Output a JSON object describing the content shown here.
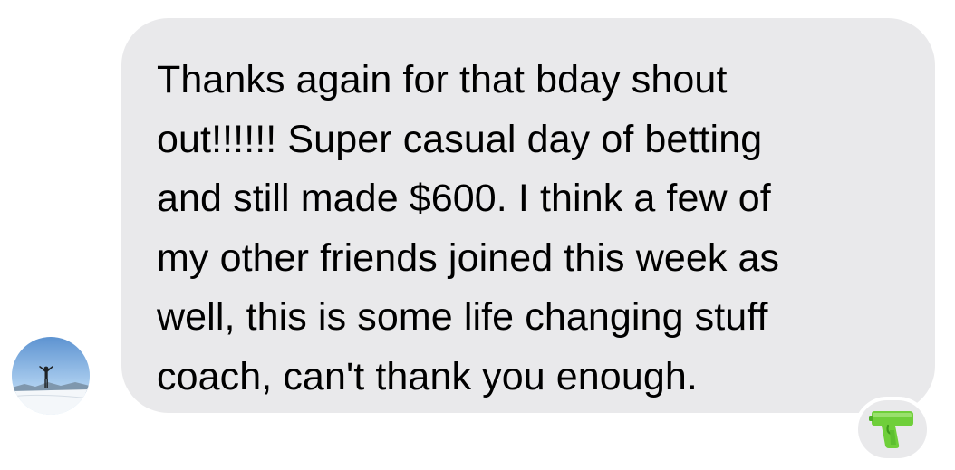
{
  "message": {
    "lines": [
      "Thanks again for that bday shout",
      "out!!!!!! Super casual day of betting",
      "and still made $600. I think a few of",
      "my other friends joined this week as",
      "well, this is some life changing stuff",
      "coach, can't thank you enough."
    ]
  },
  "sender": {
    "avatar_icon": "person-on-mountain-avatar-icon"
  },
  "reaction": {
    "emoji_icon": "water-pistol-icon",
    "color": "#6fcf3a"
  },
  "colors": {
    "bubble": "#e9e9eb",
    "text": "#000000",
    "background": "#ffffff"
  }
}
